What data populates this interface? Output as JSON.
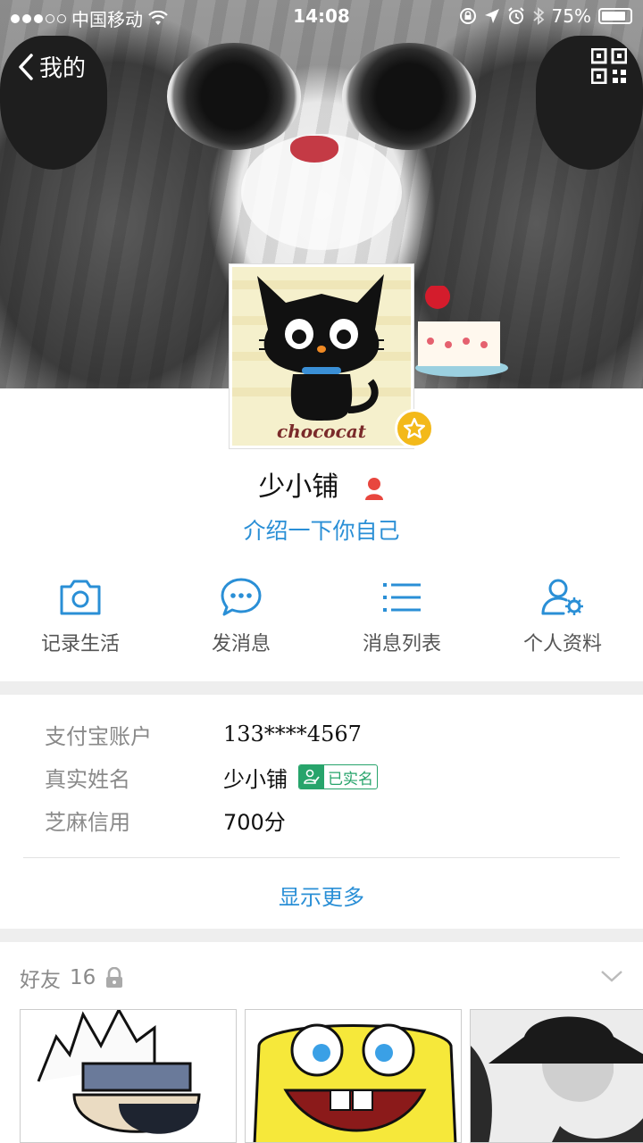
{
  "status_bar": {
    "carrier": "中国移动",
    "time": "14:08",
    "battery": "75%"
  },
  "nav": {
    "back_label": "我的",
    "back_icon": "chevron-left-icon",
    "qr_icon": "qr-code-icon"
  },
  "profile": {
    "name": "少小铺",
    "intro": "介绍一下你自己",
    "avatar_text": "chococat"
  },
  "actions": [
    {
      "label": "记录生活",
      "icon": "camera-icon"
    },
    {
      "label": "发消息",
      "icon": "chat-bubble-icon"
    },
    {
      "label": "消息列表",
      "icon": "list-icon"
    },
    {
      "label": "个人资料",
      "icon": "user-settings-icon"
    }
  ],
  "info": {
    "rows": [
      {
        "key": "支付宝账户",
        "value": "133****4567"
      },
      {
        "key": "真实姓名",
        "value": "少小铺",
        "badge": "已实名"
      },
      {
        "key": "芝麻信用",
        "value": "700分"
      }
    ],
    "more_label": "显示更多"
  },
  "friends": {
    "label": "好友",
    "count": "16"
  },
  "colors": {
    "accent": "#2a8fd6",
    "verified": "#27a46b",
    "gold": "#f3b91a"
  }
}
